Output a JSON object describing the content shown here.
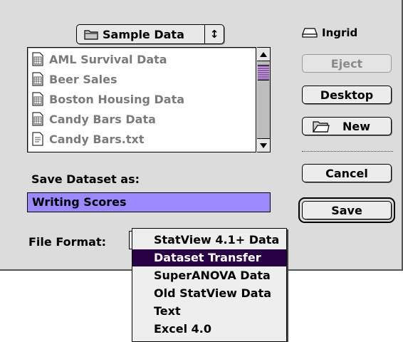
{
  "folder_popup": {
    "label": "Sample Data",
    "arrows": "↕"
  },
  "file_list": [
    {
      "name": "AML Survival Data",
      "type": "dataset"
    },
    {
      "name": "Beer Sales",
      "type": "dataset"
    },
    {
      "name": "Boston Housing Data",
      "type": "dataset"
    },
    {
      "name": "Candy Bars Data",
      "type": "dataset"
    },
    {
      "name": "Candy Bars.txt",
      "type": "text"
    }
  ],
  "disk": {
    "name": "Ingrid"
  },
  "buttons": {
    "eject": "Eject",
    "desktop": "Desktop",
    "new": "New",
    "cancel": "Cancel",
    "save": "Save"
  },
  "save_as": {
    "label": "Save Dataset as:",
    "value": "Writing Scores"
  },
  "file_format": {
    "label": "File Format:",
    "options": [
      "StatView 4.1+ Data",
      "Dataset Transfer",
      "SuperANOVA Data",
      "Old StatView Data",
      "Text",
      "Excel 4.0"
    ],
    "selected": "Dataset Transfer"
  },
  "colors": {
    "dialog_bg": "#dcdcdc",
    "name_field_bg": "#9c88ff",
    "menu_highlight": "#2a0044",
    "scroll_thumb": "#8b5ba8"
  }
}
